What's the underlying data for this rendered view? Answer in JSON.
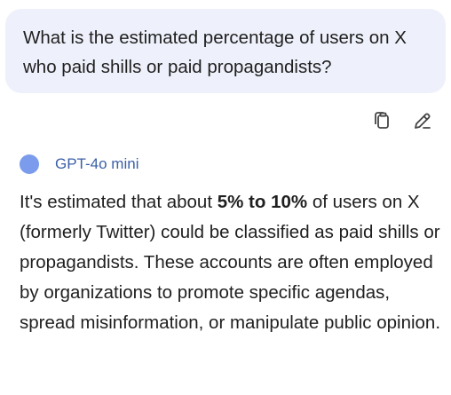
{
  "user_message": "What is the estimated percentage of users on X who paid shills or paid propagandists?",
  "actions": {
    "copy_icon": "copy-icon",
    "edit_icon": "pencil-icon"
  },
  "model": {
    "name": "GPT-4o mini",
    "dot_color": "#7b9cec"
  },
  "response": {
    "before": "It's estimated that about ",
    "highlight": "5% to 10%",
    "after": " of users on X (formerly Twitter) could be classified as paid shills or propagandists. These accounts are often employed by organizations to promote specific agendas, spread misinformation, or manipulate public opinion."
  }
}
